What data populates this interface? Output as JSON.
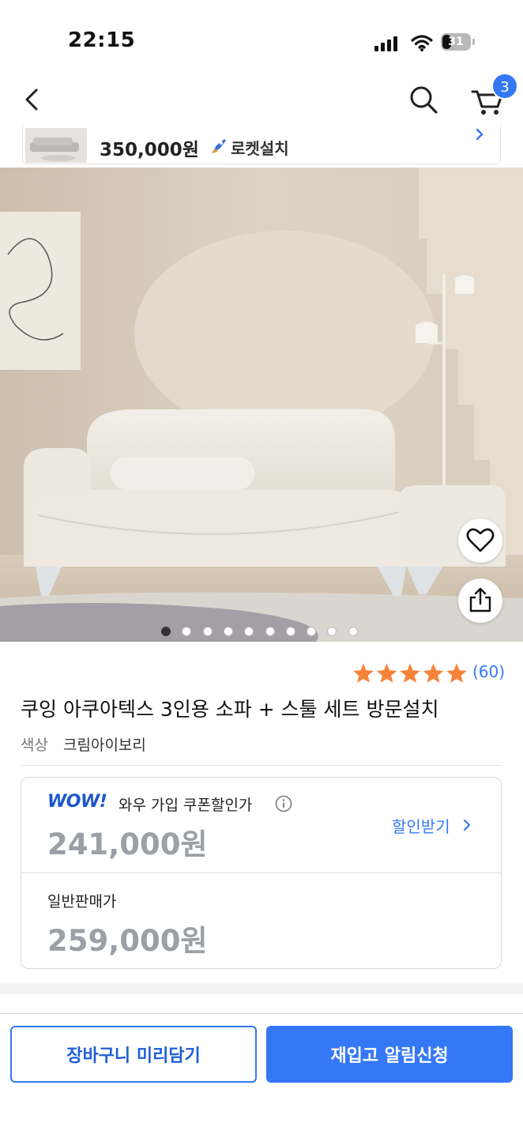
{
  "status_bar": {
    "time": "22:15",
    "battery": "31",
    "battery_level": 0.31
  },
  "nav": {
    "cart_badge": "3"
  },
  "mini_bar": {
    "price": "350,000원",
    "badge_label": "로켓설치"
  },
  "gallery": {
    "total_images": 10,
    "active_index": 0
  },
  "product": {
    "rating": 5,
    "review_count": "(60)",
    "title": "쿠잉 아쿠아텍스 3인용 소파 + 스툴 세트 방문설치",
    "option_label": "색상",
    "option_value": "크림아이보리"
  },
  "pricing": {
    "wow_logo": "WOW!",
    "wow_label": "와우 가입 쿠폰할인가",
    "wow_price": "241,000원",
    "get_discount": "할인받기",
    "regular_label": "일반판매가",
    "regular_price": "259,000원"
  },
  "actions": {
    "cart_save": "장바구니 미리담기",
    "restock_alert": "재입고 알림신청"
  },
  "colors": {
    "accent": "#3478f6",
    "star": "#f5843a",
    "price_gray": "#9aa0a6",
    "wow_blue": "#1b57c9"
  }
}
